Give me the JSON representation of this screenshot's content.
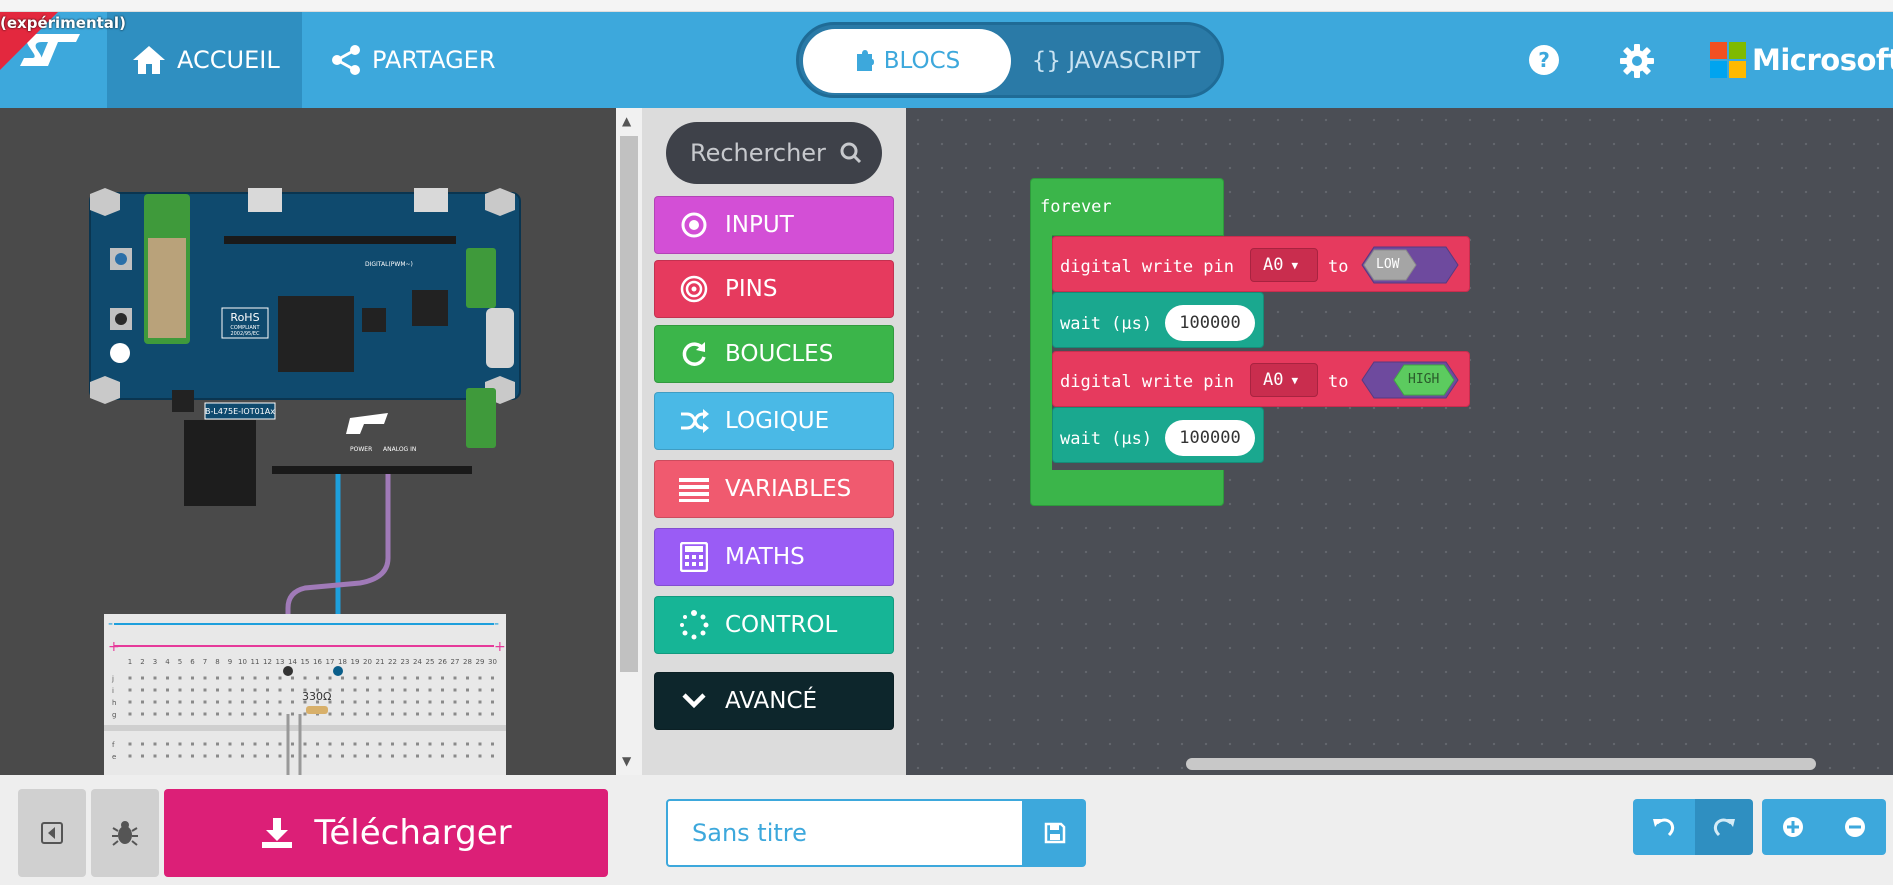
{
  "header": {
    "badge": "(expérimental)",
    "home_label": "ACCUEIL",
    "share_label": "PARTAGER",
    "toggle": {
      "blocks_label": "BLOCS",
      "js_label": "{} JAVASCRIPT",
      "active": "blocks"
    },
    "brand": "Microsoft",
    "accent": "#3da8dc"
  },
  "simulator": {
    "board_label": "B-L475E-IOT01Ax",
    "rohs_title": "RoHS",
    "rohs_sub": "COMPLIANT",
    "rohs_code": "2002/95/EC",
    "resistor_label": "330Ω",
    "power_label": "POWER",
    "analog_label": "ANALOG IN",
    "digital_label": "DIGITAL(PWM~)",
    "breadboard_columns": [
      "1",
      "2",
      "3",
      "4",
      "5",
      "6",
      "7",
      "8",
      "9",
      "10",
      "11",
      "12",
      "13",
      "14",
      "15",
      "16",
      "17",
      "18",
      "19",
      "20",
      "21",
      "22",
      "23",
      "24",
      "25",
      "26",
      "27",
      "28",
      "29",
      "30"
    ],
    "breadboard_rows": [
      "j",
      "i",
      "h",
      "g",
      "f",
      "e"
    ]
  },
  "toolbox": {
    "search_placeholder": "Rechercher",
    "categories": [
      {
        "label": "INPUT",
        "color": "#d34fd6",
        "icon": "input-target-icon"
      },
      {
        "label": "PINS",
        "color": "#e63a5e",
        "icon": "pins-circles-icon"
      },
      {
        "label": "BOUCLES",
        "color": "#3bb54a",
        "icon": "refresh-loop-icon"
      },
      {
        "label": "LOGIQUE",
        "color": "#4ab9e6",
        "icon": "shuffle-icon"
      },
      {
        "label": "VARIABLES",
        "color": "#f05a6f",
        "icon": "list-lines-icon"
      },
      {
        "label": "MATHS",
        "color": "#9a5cf5",
        "icon": "calculator-icon"
      },
      {
        "label": "CONTROL",
        "color": "#16b596",
        "icon": "dots-circle-icon"
      },
      {
        "label": "AVANCÉ",
        "color": "#0d262c",
        "icon": "chevron-down-icon"
      }
    ]
  },
  "workspace": {
    "forever_label": "forever",
    "statements": [
      {
        "kind": "digital_write",
        "text": "digital write pin",
        "pin": "A0",
        "to": "to",
        "value": "LOW"
      },
      {
        "kind": "wait",
        "text": "wait (µs)",
        "value": "100000"
      },
      {
        "kind": "digital_write",
        "text": "digital write pin",
        "pin": "A0",
        "to": "to",
        "value": "HIGH"
      },
      {
        "kind": "wait",
        "text": "wait (µs)",
        "value": "100000"
      }
    ]
  },
  "footer": {
    "download_label": "Télécharger",
    "project_name": "Sans titre",
    "download_color": "#dc1f77"
  }
}
